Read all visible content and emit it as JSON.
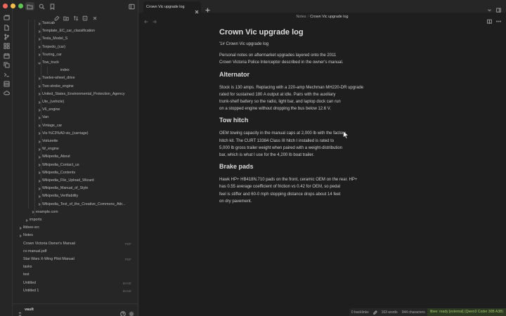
{
  "app": {
    "accent": "#7f6df2",
    "ribbon_icons": [
      "tab-switcher-icon",
      "file-icon",
      "git-branch-icon",
      "grid-icon",
      "calendar-icon",
      "copy-icon",
      "terminal-icon",
      "layers-icon",
      "cloud-icon"
    ],
    "sidebar_top_icons": [
      "folder-icon",
      "search-icon",
      "bookmark-icon"
    ],
    "sidebar_toolbar_icons": [
      "new-note-icon",
      "new-folder-icon",
      "sort-icon",
      "collapse-icon",
      "close-all-icon"
    ]
  },
  "sidebar": {
    "tree": [
      {
        "label": "Taxicab",
        "level": 3,
        "type": "folder",
        "open": false
      },
      {
        "label": "Template_EC_car_classification",
        "level": 3,
        "type": "folder",
        "open": false
      },
      {
        "label": "Tesla_Model_S",
        "level": 3,
        "type": "folder",
        "open": false
      },
      {
        "label": "Torpedo_(car)",
        "level": 3,
        "type": "folder",
        "open": false
      },
      {
        "label": "Touring_car",
        "level": 3,
        "type": "folder",
        "open": false
      },
      {
        "label": "Tow_truck",
        "level": 3,
        "type": "folder",
        "open": true
      },
      {
        "label": "index",
        "level": 4,
        "type": "file"
      },
      {
        "label": "Twelve-wheel_drive",
        "level": 3,
        "type": "folder",
        "open": false
      },
      {
        "label": "Two-stroke_engine",
        "level": 3,
        "type": "folder",
        "open": false
      },
      {
        "label": "United_States_Environmental_Protection_Agency",
        "level": 3,
        "type": "folder",
        "open": false
      },
      {
        "label": "Ute_(vehicle)",
        "level": 3,
        "type": "folder",
        "open": false
      },
      {
        "label": "V6_engine",
        "level": 3,
        "type": "folder",
        "open": false
      },
      {
        "label": "Van",
        "level": 3,
        "type": "folder",
        "open": false
      },
      {
        "label": "Vintage_car",
        "level": 3,
        "type": "folder",
        "open": false
      },
      {
        "label": "Vis-%C3%A0-vis_(carriage)",
        "level": 3,
        "type": "folder",
        "open": false
      },
      {
        "label": "Voiturette",
        "level": 3,
        "type": "folder",
        "open": false
      },
      {
        "label": "W_engine",
        "level": 3,
        "type": "folder",
        "open": false
      },
      {
        "label": "Wikipedia_About",
        "level": 3,
        "type": "folder",
        "open": false
      },
      {
        "label": "Wikipedia_Contact_us",
        "level": 3,
        "type": "folder",
        "open": false
      },
      {
        "label": "Wikipedia_Contents",
        "level": 3,
        "type": "folder",
        "open": false
      },
      {
        "label": "Wikipedia_File_Upload_Wizard",
        "level": 3,
        "type": "folder",
        "open": false
      },
      {
        "label": "Wikipedia_Manual_of_Style",
        "level": 3,
        "type": "folder",
        "open": false
      },
      {
        "label": "Wikipedia_Verifiability",
        "level": 3,
        "type": "folder",
        "open": false
      },
      {
        "label": "Wikipedia_Text_of_the_Creative_Commons_Attr...",
        "level": 3,
        "type": "folder",
        "open": false
      },
      {
        "label": "example.com",
        "level": 2,
        "type": "folder",
        "open": false
      },
      {
        "label": "imports",
        "level": 1,
        "type": "folder",
        "open": false
      },
      {
        "label": "libbee-src",
        "level": 0,
        "type": "folder",
        "open": false
      },
      {
        "label": "Notes",
        "level": 0,
        "type": "folder",
        "open": false
      },
      {
        "label": "Crown Victoria Owner's Manual",
        "level": 0,
        "type": "file",
        "ext": "PDF"
      },
      {
        "label": "cv-manual.pdf",
        "level": 0,
        "type": "file"
      },
      {
        "label": "Star Wars X-Wing Pilot Manual",
        "level": 0,
        "type": "file",
        "ext": "PDF"
      },
      {
        "label": "tasks",
        "level": 0,
        "type": "file"
      },
      {
        "label": "test",
        "level": 0,
        "type": "file"
      },
      {
        "label": "Untitled",
        "level": 0,
        "type": "file",
        "ext": "BASE"
      },
      {
        "label": "Untitled 1",
        "level": 0,
        "type": "file",
        "ext": "BASE"
      }
    ],
    "vault_name": "vault"
  },
  "tabs": [
    {
      "label": "Crown Vic upgrade log",
      "active": true
    }
  ],
  "breadcrumb": {
    "parent": "Notes",
    "separator": "/",
    "current": "Crown Vic upgrade log"
  },
  "document": {
    "title": "Crown Vic upgrade log",
    "heading_line": "'1# Crown Vic upgrade log",
    "intro": "Personal notes on aftermarket upgrades layered onto the 2011\nCrown Victoria Police Interceptor described in the owner's manual.",
    "sections": [
      {
        "heading": "Alternator",
        "body": "Stock is 130 amps. Replacing with a 220-amp Mechman MH220-DR upgrade\nrated for sustained 180 A output at idle. Pairs with the auxiliary\ntrunk-shelf battery so the radio, light bar, and laptop dock can run\non a stopped engine without dropping the bus below 12.6 V."
      },
      {
        "heading": "Tow hitch",
        "body": "OEM towing capacity in the manual caps at 2,000 lb with the factory\nhitch kit. The CURT 13384 Class III hitch I installed is rated to\n5,000 lb gross trailer weight when paired with a weight-distribution\nbar, which is what I use for the 4,200 lb boat trailer."
      },
      {
        "heading": "Brake pads",
        "body": "Hawk HP+ HB418N.710 pads on the front, ceramic OEM on the rear. HP+\nhas 0.55 average coefficient of friction vs 0.42 for OEM, so pedal\nfeel is stiffer and 60-0 mph stopping distance drops about 14 feet\non dry pavement."
      }
    ]
  },
  "status_bar": {
    "backlinks": "0 backlinks",
    "words": "163 words",
    "characters": "944 characters",
    "llm_status": "libee: ready [external] (Qwen3 Coder 30B A3B)"
  }
}
